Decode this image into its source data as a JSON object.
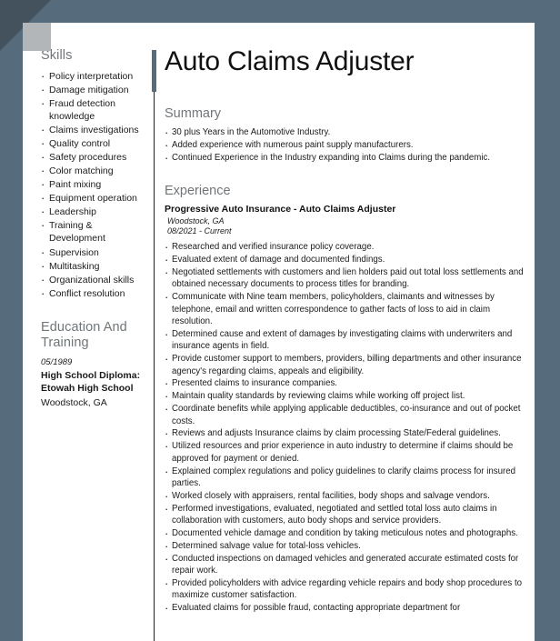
{
  "theme": {
    "background": "#566b7b",
    "page": "#ffffff",
    "heading_color": "#6f7579",
    "accent_bar": "#566b7b",
    "rule_color": "#222222",
    "corner_fold_dark": "#44525e",
    "corner_fold_grey": "#b3b6b8"
  },
  "document": {
    "title": "Auto Claims Adjuster"
  },
  "sidebar": {
    "skills": {
      "heading": "Skills",
      "items": [
        "Policy interpretation",
        "Damage mitigation",
        "Fraud detection knowledge",
        "Claims investigations",
        "Quality control",
        "Safety procedures",
        "Color matching",
        "Paint mixing",
        "Equipment operation",
        "Leadership",
        "Training & Development",
        "Supervision",
        "Multitasking",
        "Organizational skills",
        "Conflict resolution"
      ]
    },
    "education": {
      "heading": "Education And Training",
      "date": "05/1989",
      "degree": "High School Diploma: Etowah High School",
      "location": "Woodstock, GA"
    }
  },
  "main": {
    "summary": {
      "heading": "Summary",
      "items": [
        "30 plus Years in the Automotive Industry.",
        "Added experience with numerous paint supply manufacturers.",
        "Continued Experience in the Industry expanding into Claims during the pandemic."
      ]
    },
    "experience": {
      "heading": "Experience",
      "job_title": "Progressive Auto Insurance - Auto Claims Adjuster",
      "job_location": "Woodstock, GA",
      "job_dates": "08/2021 - Current",
      "items": [
        "Researched and verified insurance policy coverage.",
        "Evaluated extent of damage and documented findings.",
        "Negotiated settlements with customers and lien holders paid out total loss settlements and obtained necessary documents to process titles for branding.",
        "Communicate with Nine team members, policyholders, claimants and witnesses by telephone, email and written correspondence to gather facts of loss to aid in claim resolution.",
        "Determined cause and extent of damages by investigating claims with underwriters and insurance agents in field.",
        "Provide customer support to members, providers, billing departments and other insurance agency's regarding claims, appeals and eligibility.",
        "Presented claims to insurance companies.",
        "Maintain quality standards by reviewing claims while working off project list.",
        "Coordinate benefits while applying applicable deductibles, co-insurance and out of pocket costs.",
        "Reviews and adjusts Insurance claims by claim processing State/Federal guidelines.",
        "Utilized resources and prior experience in auto industry to determine if claims should be approved for payment or denied.",
        "Explained complex regulations and policy guidelines to clarify claims process for insured parties.",
        "Worked closely with appraisers, rental facilities, body shops and salvage vendors.",
        "Performed investigations, evaluated, negotiated and settled total loss auto claims in collaboration with customers, auto body shops and service providers.",
        "Documented vehicle damage and condition by taking meticulous notes and photographs.",
        "Determined salvage value for total-loss vehicles.",
        "Conducted inspections on damaged vehicles and generated accurate estimated costs for repair work.",
        "Provided policyholders with advice regarding vehicle repairs and body shop procedures to maximize customer satisfaction.",
        "Evaluated claims for possible fraud, contacting appropriate department for"
      ]
    }
  }
}
